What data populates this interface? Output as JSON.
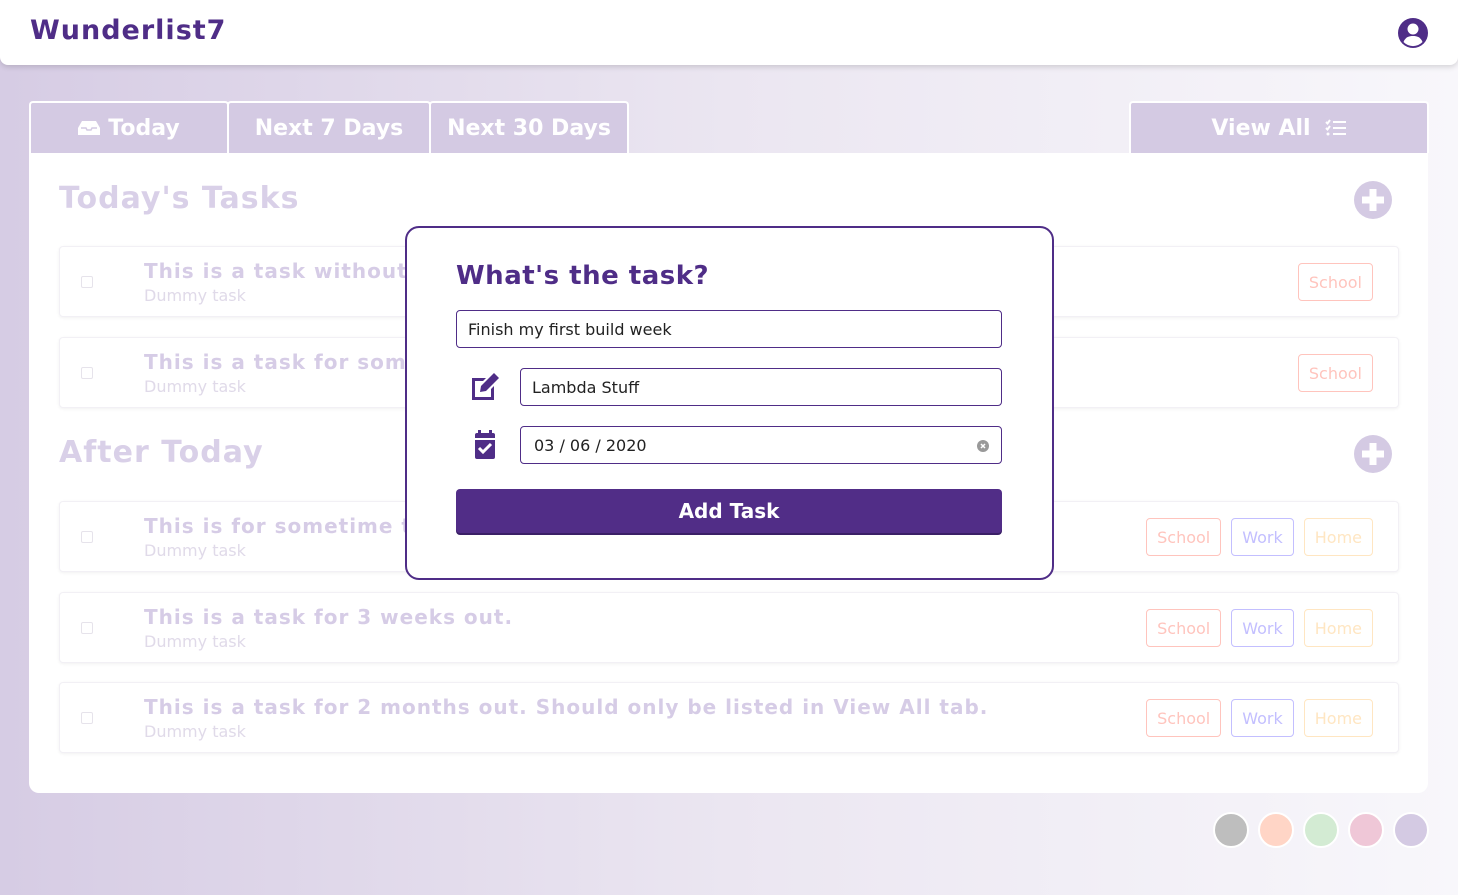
{
  "app": {
    "title": "Wunderlist7"
  },
  "tabs": [
    {
      "label": "Today",
      "icon": "inbox-icon"
    },
    {
      "label": "Next 7 Days"
    },
    {
      "label": "Next 30 Days"
    },
    {
      "label": "View All",
      "icon": "list-check-icon"
    }
  ],
  "sections": {
    "today": {
      "title": "Today's Tasks",
      "tasks": [
        {
          "title": "This is a task without a",
          "description": "Dummy task",
          "tags": [
            "School"
          ]
        },
        {
          "title": "This is a task for somet",
          "description": "Dummy task",
          "tags": [
            "School"
          ]
        }
      ]
    },
    "after": {
      "title": "After Today",
      "tasks": [
        {
          "title": "This is for sometime thi",
          "description": "Dummy task",
          "tags": [
            "School",
            "Work",
            "Home"
          ]
        },
        {
          "title": "This is a task for 3 weeks out.",
          "description": "Dummy task",
          "tags": [
            "School",
            "Work",
            "Home"
          ]
        },
        {
          "title": "This is a task for 2 months out. Should only be listed in View All tab.",
          "description": "Dummy task",
          "tags": [
            "School",
            "Work",
            "Home"
          ]
        }
      ]
    }
  },
  "modal": {
    "heading": "What's the task?",
    "task_value": "Finish my first build week",
    "category_value": "Lambda Stuff",
    "date_value": "03 / 06 / 2020",
    "submit_label": "Add Task"
  },
  "theme_colors": [
    "#bebebe",
    "#ffd5c6",
    "#d3ebd3",
    "#efc7d7",
    "#d4cae3"
  ],
  "accent": "#4f2d87"
}
